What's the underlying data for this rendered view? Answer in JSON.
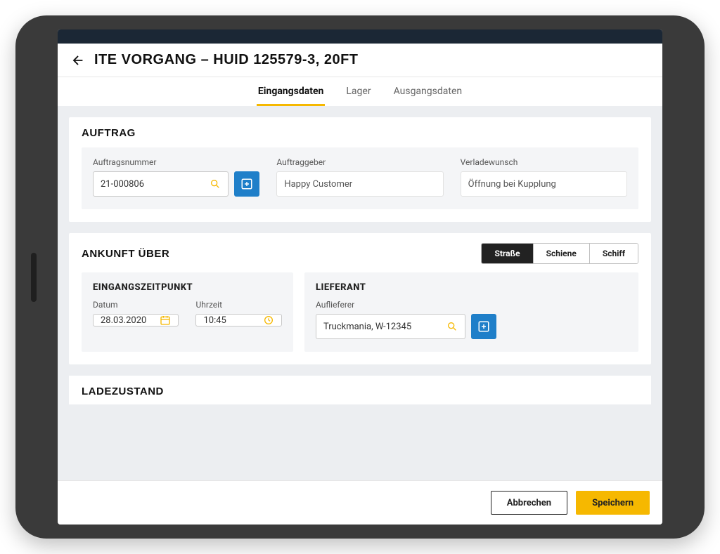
{
  "header": {
    "title": "ITE Vorgang – HUID 125579-3, 20ft"
  },
  "tabs": [
    {
      "label": "Eingangsdaten",
      "active": true
    },
    {
      "label": "Lager",
      "active": false
    },
    {
      "label": "Ausgangsdaten",
      "active": false
    }
  ],
  "sections": {
    "auftrag": {
      "title": "Auftrag",
      "fields": {
        "auftragsnummer": {
          "label": "Auftragsnummer",
          "value": "21-000806"
        },
        "auftraggeber": {
          "label": "Auftraggeber",
          "value": "Happy Customer"
        },
        "verladewunsch": {
          "label": "Verladewunsch",
          "value": "Öffnung bei Kupplung"
        }
      }
    },
    "ankunft": {
      "title": "Ankunft über",
      "segment": [
        {
          "label": "Straße",
          "active": true
        },
        {
          "label": "Schiene",
          "active": false
        },
        {
          "label": "Schiff",
          "active": false
        }
      ],
      "eingang": {
        "title": "Eingangszeitpunkt",
        "datum": {
          "label": "Datum",
          "value": "28.03.2020"
        },
        "uhrzeit": {
          "label": "Uhrzeit",
          "value": "10:45"
        }
      },
      "lieferant": {
        "title": "Lieferant",
        "auflieferer": {
          "label": "Auflieferer",
          "value": "Truckmania, W-12345"
        }
      }
    },
    "ladezustand": {
      "title": "Ladezustand"
    }
  },
  "footer": {
    "cancel": "Abbrechen",
    "save": "Speichern"
  },
  "colors": {
    "accent": "#f6b800",
    "primaryBtn": "#1f7fc9"
  }
}
